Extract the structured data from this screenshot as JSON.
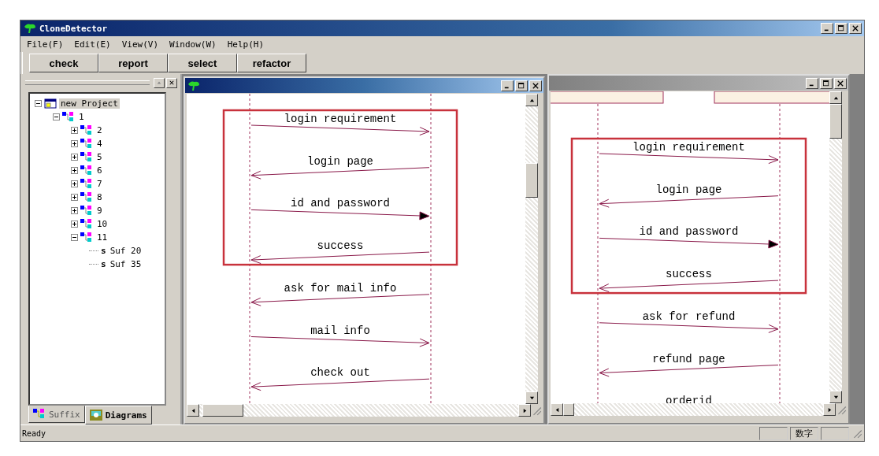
{
  "window": {
    "title": "CloneDetector"
  },
  "menu": [
    "File(F)",
    "Edit(E)",
    "View(V)",
    "Window(W)",
    "Help(H)"
  ],
  "toolbar": [
    "check",
    "report",
    "select",
    "refactor"
  ],
  "project_tree": {
    "items": [
      {
        "label": "new Project",
        "kind": "project",
        "expanded": true,
        "selected": true,
        "children": [
          {
            "label": "1",
            "kind": "node",
            "expanded": true,
            "selected": false,
            "children": [
              {
                "label": "2",
                "kind": "node",
                "expanded": false,
                "selected": false
              },
              {
                "label": "4",
                "kind": "node",
                "expanded": false,
                "selected": false
              },
              {
                "label": "5",
                "kind": "node",
                "expanded": false,
                "selected": false
              },
              {
                "label": "6",
                "kind": "node",
                "expanded": false,
                "selected": false
              },
              {
                "label": "7",
                "kind": "node",
                "expanded": false,
                "selected": false
              },
              {
                "label": "8",
                "kind": "node",
                "expanded": false,
                "selected": false
              },
              {
                "label": "9",
                "kind": "node",
                "expanded": false,
                "selected": false
              },
              {
                "label": "10",
                "kind": "node",
                "expanded": false,
                "selected": false
              },
              {
                "label": "11",
                "kind": "node",
                "expanded": true,
                "selected": false,
                "children": [
                  {
                    "label": "Suf 20",
                    "kind": "suffix",
                    "marker": "s",
                    "selected": false
                  },
                  {
                    "label": "Suf 35",
                    "kind": "suffix",
                    "marker": "s",
                    "selected": false
                  }
                ]
              }
            ]
          }
        ]
      }
    ]
  },
  "panel_tabs": [
    {
      "label": "Suffix",
      "kind": "suffix",
      "selected": false
    },
    {
      "label": "Diagrams",
      "kind": "diagrams",
      "selected": true
    }
  ],
  "diagram_windows": [
    {
      "active": true,
      "scrolled_to_top": false,
      "clone_messages": [
        {
          "label": "login requirement",
          "leftward": false,
          "filled_head": false
        },
        {
          "label": "login page",
          "leftward": true,
          "filled_head": false
        },
        {
          "label": "id and password",
          "leftward": false,
          "filled_head": true
        },
        {
          "label": "success",
          "leftward": true,
          "filled_head": false
        }
      ],
      "other_messages": [
        {
          "label": "ask for mail info",
          "leftward": true,
          "filled_head": false
        },
        {
          "label": "mail info",
          "leftward": false,
          "filled_head": false
        },
        {
          "label": "check out",
          "leftward": true,
          "filled_head": false
        }
      ]
    },
    {
      "active": false,
      "scrolled_to_top": true,
      "clone_messages": [
        {
          "label": "login requirement",
          "leftward": false,
          "filled_head": false
        },
        {
          "label": "login page",
          "leftward": true,
          "filled_head": false
        },
        {
          "label": "id and password",
          "leftward": false,
          "filled_head": true
        },
        {
          "label": "success",
          "leftward": true,
          "filled_head": false
        }
      ],
      "other_messages": [
        {
          "label": "ask for refund",
          "leftward": false,
          "filled_head": false
        },
        {
          "label": "refund page",
          "leftward": true,
          "filled_head": false
        },
        {
          "label": "orderid"
        }
      ]
    }
  ],
  "status_bar": {
    "text": "Ready",
    "indicators": [
      "数字"
    ]
  }
}
